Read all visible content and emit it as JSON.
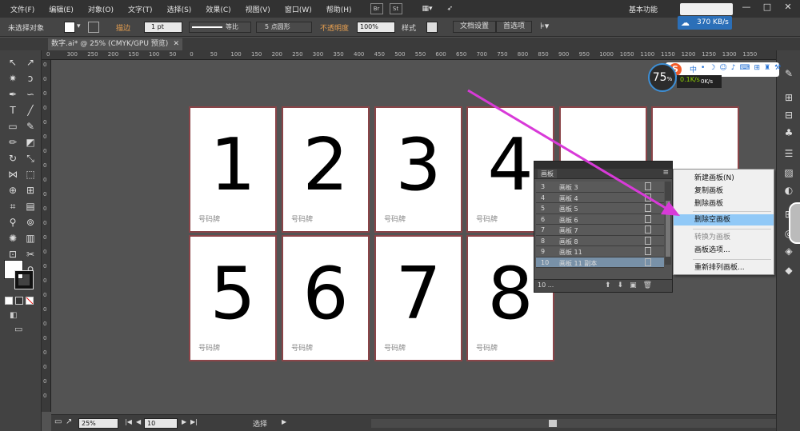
{
  "menubar": {
    "items": [
      "文件(F)",
      "编辑(E)",
      "对象(O)",
      "文字(T)",
      "选择(S)",
      "效果(C)",
      "视图(V)",
      "窗口(W)",
      "帮助(H)"
    ],
    "apps": [
      "Br",
      "St"
    ],
    "workspace": "基本功能",
    "window_buttons": [
      "—",
      "□",
      "✕"
    ]
  },
  "controlbar": {
    "no_selection": "未选择对象",
    "stroke_label": "描边",
    "stroke_weight": "1 pt",
    "stroke_profile": "等比",
    "brush": "5 点圆形",
    "opacity_label": "不透明度",
    "opacity_value": "100%",
    "style_label": "样式",
    "doc_setup": "文档设置",
    "preferences": "首选项"
  },
  "netspeed": "370 KB/s",
  "document_tab": "数字.ai* @ 25% (CMYK/GPU 预览)",
  "ruler": {
    "h": [
      "0",
      "300",
      "250",
      "200",
      "150",
      "100",
      "50",
      "0",
      "50",
      "100",
      "150",
      "200",
      "250",
      "300",
      "350",
      "400",
      "450",
      "500",
      "550",
      "600",
      "650",
      "700",
      "750",
      "800",
      "850",
      "900",
      "950",
      "1000",
      "1050",
      "1100",
      "1150",
      "1200",
      "1250",
      "1300",
      "1350"
    ],
    "v": [
      "0",
      "0",
      "0",
      "0",
      "0",
      "0",
      "0",
      "0",
      "0",
      "0",
      "0",
      "0",
      "0",
      "0",
      "0",
      "0",
      "0",
      "0",
      "0",
      "0",
      "0",
      "0",
      "0",
      "0"
    ]
  },
  "artboards": [
    {
      "num": "1",
      "caption": "号码牌"
    },
    {
      "num": "2",
      "caption": "号码牌"
    },
    {
      "num": "3",
      "caption": "号码牌"
    },
    {
      "num": "4",
      "caption": "号码牌"
    },
    {
      "num": "",
      "caption": ""
    },
    {
      "num": "",
      "caption": ""
    },
    {
      "num": "5",
      "caption": "号码牌"
    },
    {
      "num": "6",
      "caption": "号码牌"
    },
    {
      "num": "7",
      "caption": "号码牌"
    },
    {
      "num": "8",
      "caption": "号码牌"
    }
  ],
  "artboard_panel": {
    "title": "画板",
    "rows": [
      {
        "n": "3",
        "label": "画板 3"
      },
      {
        "n": "4",
        "label": "画板 4"
      },
      {
        "n": "5",
        "label": "画板 5"
      },
      {
        "n": "6",
        "label": "画板 6"
      },
      {
        "n": "7",
        "label": "画板 7"
      },
      {
        "n": "8",
        "label": "画板 8"
      },
      {
        "n": "9",
        "label": "画板 11"
      },
      {
        "n": "10",
        "label": "画板 11 副本"
      }
    ],
    "selected_index": 7,
    "count": "10 ..."
  },
  "context_menu": {
    "items": [
      {
        "label": "新建画板(N)",
        "state": "normal"
      },
      {
        "label": "复制画板",
        "state": "normal"
      },
      {
        "label": "删除画板",
        "state": "normal"
      },
      {
        "label": "删除空画板",
        "state": "highlighted"
      },
      {
        "label": "转换为画板",
        "state": "disabled"
      },
      {
        "label": "画板选项...",
        "state": "normal"
      },
      {
        "label": "重新排列画板...",
        "state": "normal"
      }
    ]
  },
  "statusbar": {
    "zoom": "25%",
    "artboard": "10",
    "tool": "选择"
  },
  "meter": {
    "value": "75",
    "unit": "%",
    "bar_top": "0.1K/s",
    "bar_bottom": "0K/s"
  },
  "colors": {
    "accent": "#3d8fd6",
    "artboard_border": "#8a4448",
    "arrow": "#d83ad8",
    "highlight": "#91c9f7"
  }
}
